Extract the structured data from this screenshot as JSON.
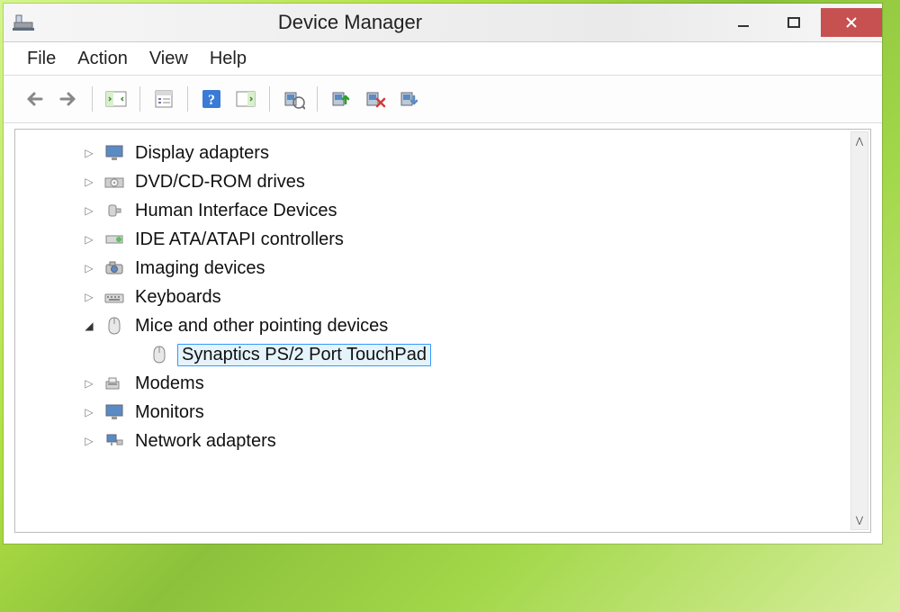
{
  "window": {
    "title": "Device Manager"
  },
  "menu": {
    "file": "File",
    "action": "Action",
    "view": "View",
    "help": "Help"
  },
  "toolbar_icons": {
    "back": "back-arrow",
    "forward": "forward-arrow",
    "show_hide_tree": "show-hide-tree",
    "properties": "properties",
    "help": "help",
    "refresh": "refresh",
    "update_driver": "update-driver",
    "uninstall": "uninstall",
    "disable": "disable",
    "scan": "scan-for-hardware-changes"
  },
  "tree": {
    "items": [
      {
        "label": "Display adapters",
        "icon": "monitor-icon",
        "expanded": false
      },
      {
        "label": "DVD/CD-ROM drives",
        "icon": "optical-drive-icon",
        "expanded": false
      },
      {
        "label": "Human Interface Devices",
        "icon": "hid-icon",
        "expanded": false
      },
      {
        "label": "IDE ATA/ATAPI controllers",
        "icon": "controller-icon",
        "expanded": false
      },
      {
        "label": "Imaging devices",
        "icon": "camera-icon",
        "expanded": false
      },
      {
        "label": "Keyboards",
        "icon": "keyboard-icon",
        "expanded": false
      },
      {
        "label": "Mice and other pointing devices",
        "icon": "mouse-icon",
        "expanded": true,
        "children": [
          {
            "label": "Synaptics PS/2 Port TouchPad",
            "icon": "mouse-icon",
            "selected": true
          }
        ]
      },
      {
        "label": "Modems",
        "icon": "modem-icon",
        "expanded": false
      },
      {
        "label": "Monitors",
        "icon": "monitor-icon",
        "expanded": false
      },
      {
        "label": "Network adapters",
        "icon": "network-icon",
        "expanded": false
      }
    ]
  }
}
